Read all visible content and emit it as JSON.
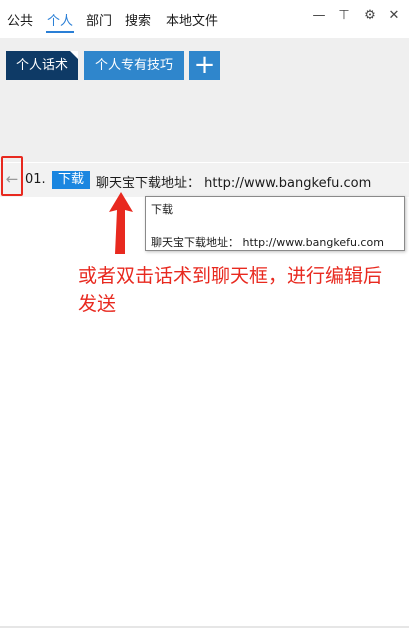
{
  "tabs": [
    {
      "label": "公共"
    },
    {
      "label": "个人"
    },
    {
      "label": "部门"
    },
    {
      "label": "搜索"
    },
    {
      "label": "本地文件"
    }
  ],
  "window_controls": {
    "minimize_glyph": "—",
    "pin_glyph": "⊤",
    "settings_glyph": "⚙",
    "close_glyph": "✕"
  },
  "categories": [
    {
      "label": "个人话术"
    },
    {
      "label": "个人专有技巧"
    }
  ],
  "add_button": {
    "glyph": "+"
  },
  "item": {
    "back_glyph": "←",
    "number": "01.",
    "badge": "下载",
    "text": "聊天宝下载地址： http://www.bangkefu.com"
  },
  "tooltip": {
    "title": "下载",
    "body": "聊天宝下载地址： http://www.bangkefu.com"
  },
  "annotation": {
    "text": "或者双击话术到聊天框，进行编辑后发送"
  },
  "colors": {
    "accent": "#2a7fd6",
    "dark_button": "#0e3a66",
    "mid_button": "#2f86cc",
    "badge": "#1a86e0",
    "annotation_red": "#e8291f"
  }
}
